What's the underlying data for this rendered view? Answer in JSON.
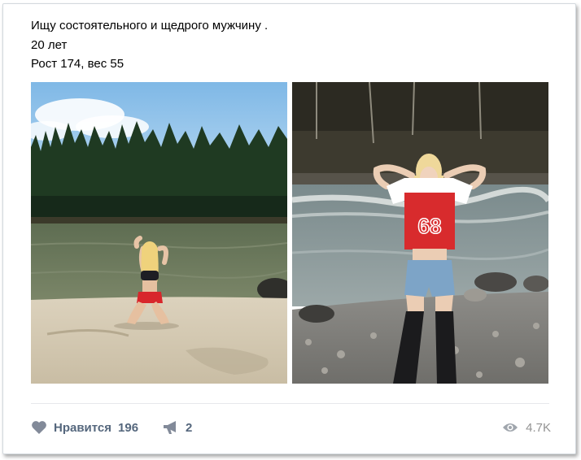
{
  "post": {
    "lines": [
      "Ищу состоятельного и щедрого мужчину .",
      "20 лет",
      "Рост 174, вес 55"
    ],
    "photos": [
      {
        "alt": ""
      },
      {
        "alt": ""
      }
    ]
  },
  "actions": {
    "like_label": "Нравится",
    "like_count": "196",
    "share_count": "2",
    "views_count": "4.7K"
  },
  "icons": {
    "like": "heart-icon",
    "share": "megaphone-icon",
    "views": "eye-icon"
  },
  "colors": {
    "action_text": "#55677d",
    "icon": "#828a99",
    "views_text": "#939393",
    "border": "#d3d9de"
  }
}
